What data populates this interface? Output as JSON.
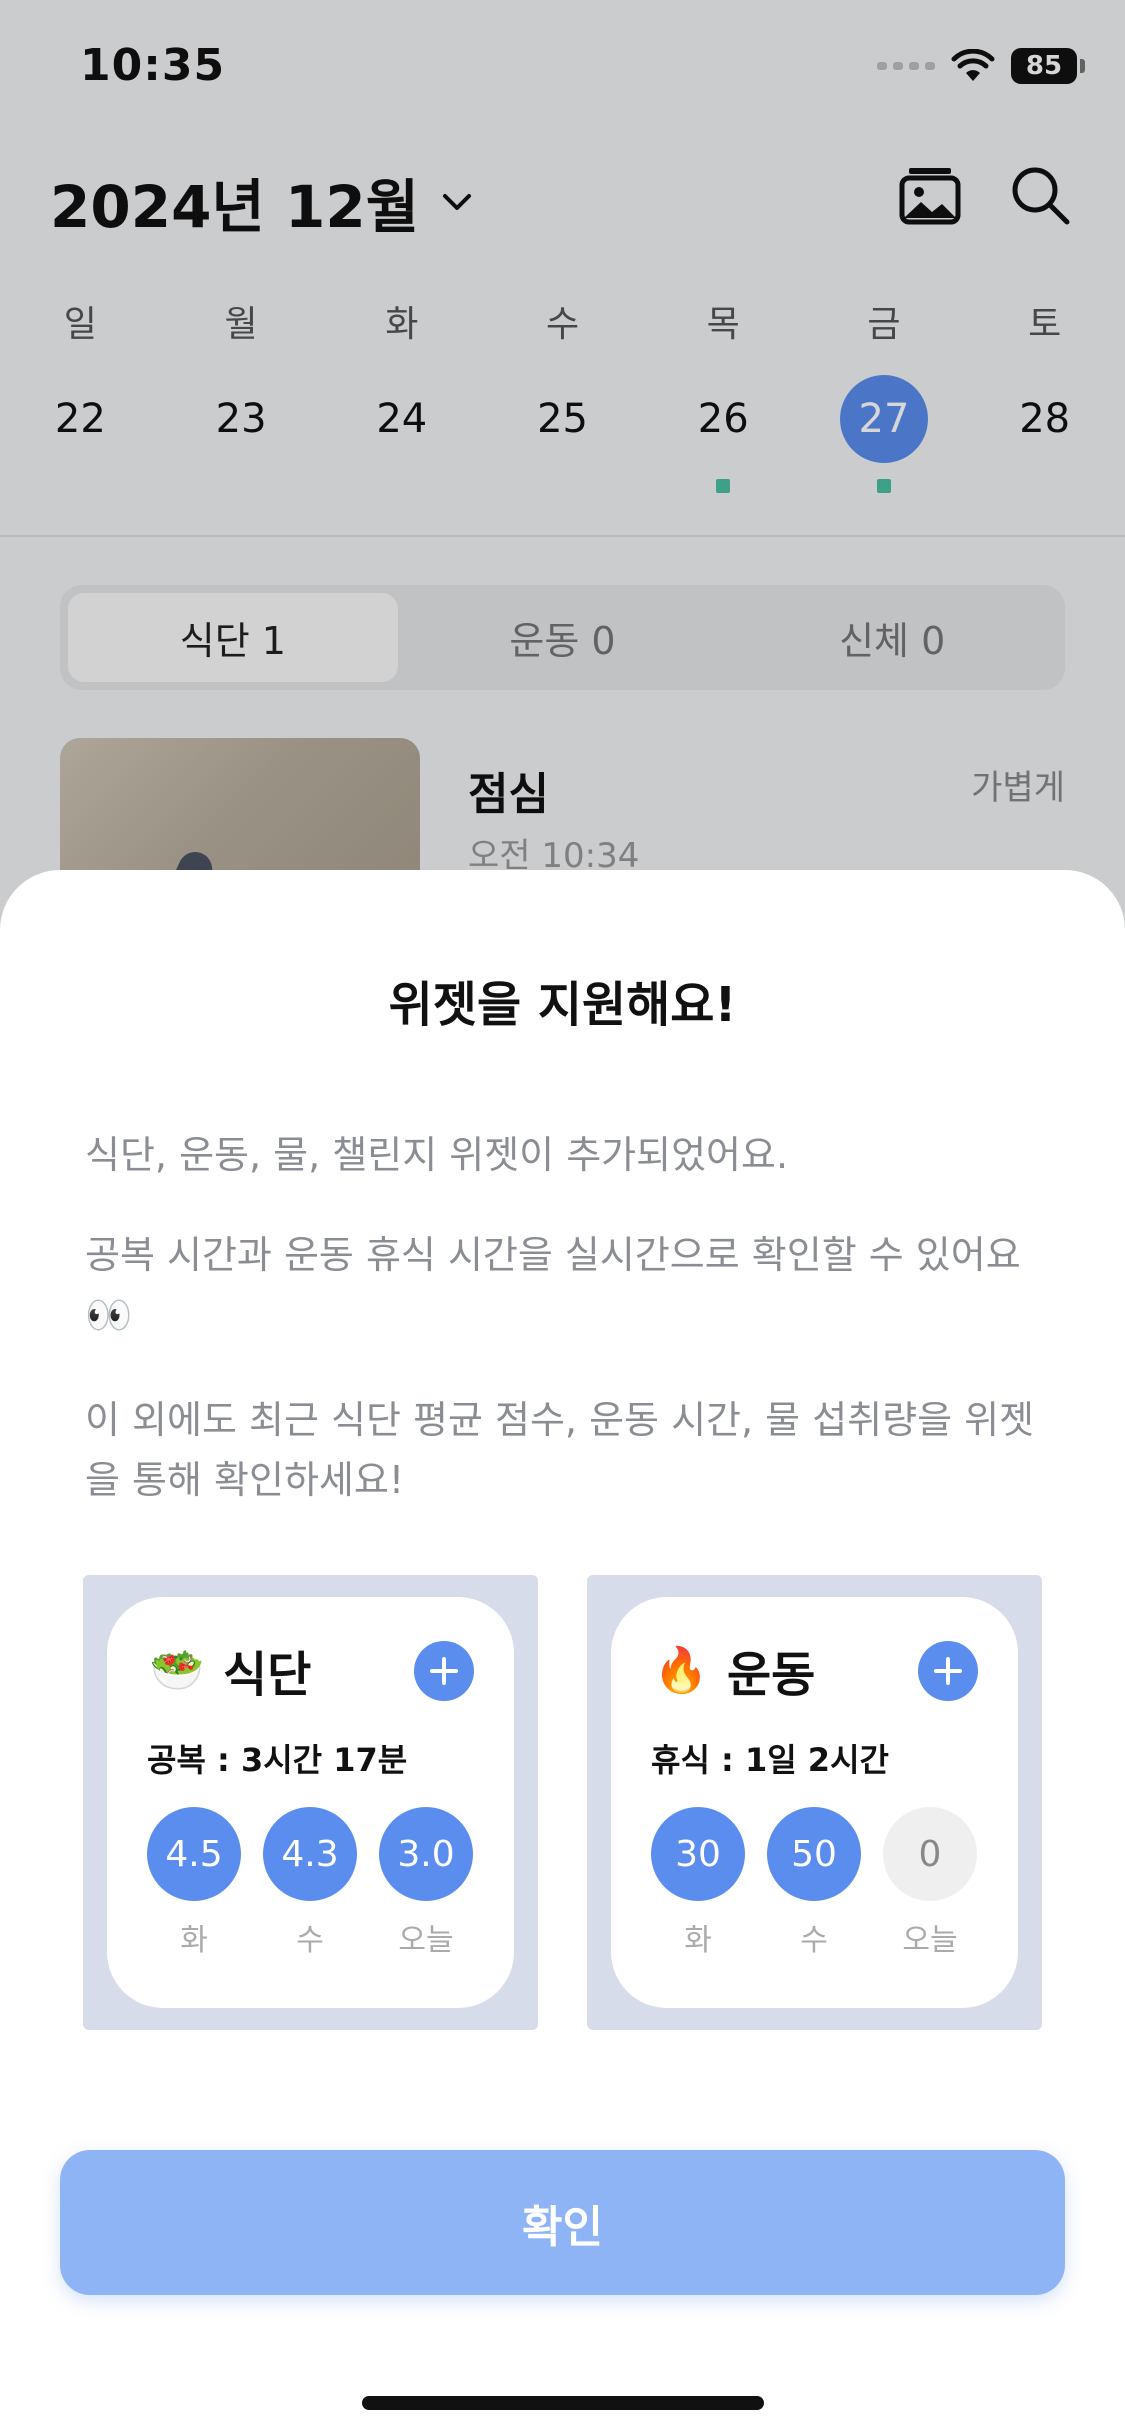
{
  "status_bar": {
    "time": "10:35",
    "battery": "85"
  },
  "header": {
    "title": "2024년 12월"
  },
  "week": {
    "weekdays": [
      "일",
      "월",
      "화",
      "수",
      "목",
      "금",
      "토"
    ],
    "dates": [
      "22",
      "23",
      "24",
      "25",
      "26",
      "27",
      "28"
    ],
    "selected_index": 5,
    "dots_on": [
      4,
      5
    ]
  },
  "tabs": [
    {
      "label": "식단 1",
      "active": true
    },
    {
      "label": "운동 0",
      "active": false
    },
    {
      "label": "신체 0",
      "active": false
    }
  ],
  "meal": {
    "title": "점심",
    "time": "오전 10:34",
    "tag": "가볍게"
  },
  "sheet": {
    "title": "위젯을 지원해요!",
    "paragraph1": "식단, 운동, 물, 챌린지 위젯이 추가되었어요.",
    "paragraph2": "공복 시간과 운동 휴식 시간을 실시간으로 확인할 수 있어요 👀",
    "paragraph3": "이 외에도 최근 식단 평균 점수, 운동 시간, 물 섭취량을 위젯을 통해 확인하세요!",
    "confirm_label": "확인"
  },
  "widgets": {
    "meal": {
      "emoji": "🥗",
      "title": "식단",
      "subtitle": "공복 : 3시간 17분",
      "values": [
        "4.5",
        "4.3",
        "3.0"
      ],
      "labels": [
        "화",
        "수",
        "오늘"
      ]
    },
    "exercise": {
      "emoji": "🔥",
      "title": "운동",
      "subtitle": "휴식 : 1일 2시간",
      "values": [
        "30",
        "50",
        "0"
      ],
      "labels": [
        "화",
        "수",
        "오늘"
      ]
    }
  },
  "colors": {
    "accent": "#5a8dee",
    "confirm": "#8fb4f6",
    "dot": "#4cbfa4"
  }
}
